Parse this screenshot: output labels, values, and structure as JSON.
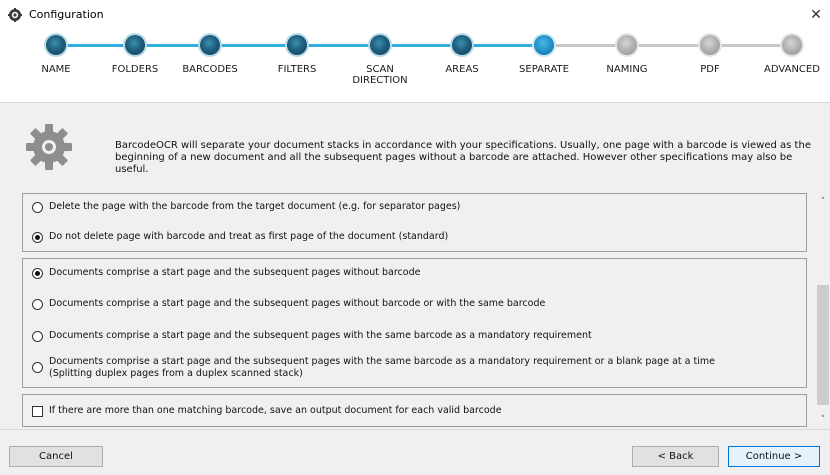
{
  "window": {
    "title": "Configuration",
    "close_glyph": "✕",
    "app_icon": "settings-app-icon"
  },
  "steps": [
    {
      "label": "NAME",
      "state": "done"
    },
    {
      "label": "FOLDERS",
      "state": "done"
    },
    {
      "label": "BARCODES",
      "state": "done"
    },
    {
      "label": "FILTERS",
      "state": "done"
    },
    {
      "label": "SCAN DIRECTION",
      "state": "done"
    },
    {
      "label": "AREAS",
      "state": "done"
    },
    {
      "label": "SEPARATE",
      "state": "active"
    },
    {
      "label": "NAMING",
      "state": "todo"
    },
    {
      "label": "PDF",
      "state": "todo"
    },
    {
      "label": "ADVANCED",
      "state": "todo"
    }
  ],
  "colors": {
    "line_done": "#2fb0dc",
    "line_todo": "#c8c8c8"
  },
  "info": {
    "icon": "gear-icon",
    "text": "BarcodeOCR will separate your document stacks in accordance with your specifications. Usually, one page with a barcode is viewed as the beginning of a new document and all the subsequent pages without a barcode are attached. However other specifications may also be useful."
  },
  "group1": {
    "options": [
      {
        "label": "Delete the page with the barcode from the target document (e.g. for separator pages)",
        "selected": false
      },
      {
        "label": "Do not delete page with barcode and treat as first page of the document (standard)",
        "selected": true
      }
    ]
  },
  "group2": {
    "options": [
      {
        "label": "Documents comprise a start page and the subsequent pages without barcode",
        "selected": true
      },
      {
        "label": "Documents comprise a start page and the subsequent pages without barcode or with the same barcode",
        "selected": false
      },
      {
        "label": "Documents comprise a start page and the subsequent pages with the same barcode as a mandatory requirement",
        "selected": false
      },
      {
        "label": "Documents comprise a start page and the subsequent pages with the same barcode as a mandatory requirement or a blank page at a time",
        "label2": "(Splitting duplex pages from a  duplex scanned stack)",
        "selected": false
      }
    ]
  },
  "group3": {
    "checkbox_label": "If there are more than one matching barcode, save an output document for each valid barcode",
    "checked": false
  },
  "scrollbar": {
    "up_glyph": "˄",
    "down_glyph": "˅"
  },
  "footer": {
    "cancel_label": "Cancel",
    "back_label": "< Back",
    "continue_label": "Continue >"
  }
}
